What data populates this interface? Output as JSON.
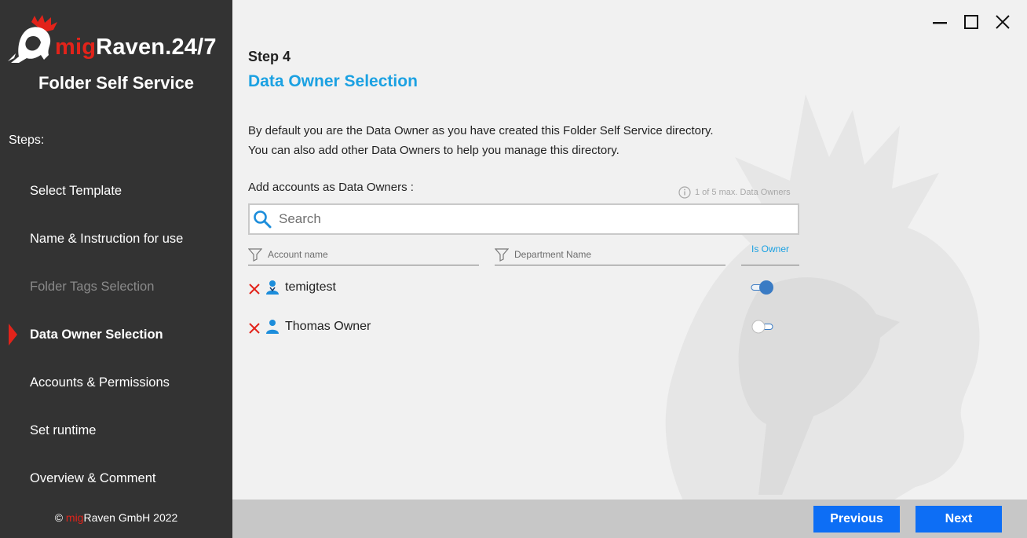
{
  "brand": {
    "prefix": "mig",
    "suffix": "Raven.24/7",
    "subtitle": "Folder Self Service"
  },
  "sidebar": {
    "steps_label": "Steps:",
    "items": [
      {
        "label": "Select Template",
        "state": "normal"
      },
      {
        "label": "Name & Instruction for use",
        "state": "normal"
      },
      {
        "label": "Folder Tags Selection",
        "state": "disabled"
      },
      {
        "label": "Data Owner Selection",
        "state": "active"
      },
      {
        "label": "Accounts & Permissions",
        "state": "normal"
      },
      {
        "label": "Set runtime",
        "state": "normal"
      },
      {
        "label": "Overview & Comment",
        "state": "normal"
      }
    ],
    "copyright": {
      "symbol": "©",
      "brand_prefix": "mig",
      "rest": "Raven GmbH 2022"
    }
  },
  "main": {
    "step_number": "Step 4",
    "step_title": "Data Owner Selection",
    "description_line1": "By default you are the Data Owner as you have created this Folder Self Service directory.",
    "description_line2": "You can also add other Data Owners to help you manage this directory.",
    "add_label": "Add accounts as Data Owners :",
    "count_hint": "1 of 5 max. Data Owners",
    "search_placeholder": "Search",
    "columns": {
      "account": "Account name",
      "department": "Department Name",
      "owner": "Is Owner"
    },
    "owners": [
      {
        "name": "temigtest",
        "department": "",
        "is_owner": true
      },
      {
        "name": "Thomas Owner",
        "department": "",
        "is_owner": false
      }
    ]
  },
  "footer": {
    "previous": "Previous",
    "next": "Next"
  },
  "colors": {
    "accent": "#1ba1e2",
    "brand_red": "#e2231a",
    "button": "#0d6ef5",
    "sidebar": "#333333",
    "toggle_on": "#3a7bc4"
  }
}
